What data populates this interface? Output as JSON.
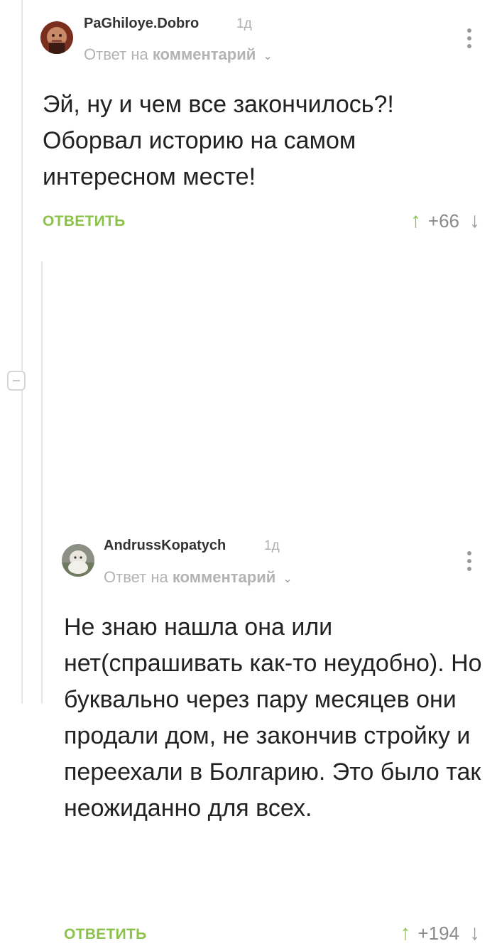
{
  "comments": [
    {
      "username": "PaGhiloye.Dobro",
      "time": "1д",
      "reply_prefix": "Ответ на",
      "reply_target": "комментарий",
      "text": "Эй, ну и чем все закончилось?! Оборвал историю на самом интересном месте!",
      "reply_label": "ОТВЕТИТЬ",
      "score": "+66"
    },
    {
      "username": "AndrussKopatych",
      "time": "1д",
      "reply_prefix": "Ответ на",
      "reply_target": "комментарий",
      "text": "Не знаю нашла она или нет(спрашивать как-то неудобно). Но буквально через пару месяцев они продали дом, не закончив стройку и переехали в Болгарию. Это было так неожиданно для всех.",
      "reply_label": "ОТВЕТИТЬ",
      "score": "+194"
    }
  ],
  "icons": {
    "upvote": "arrow-up-icon",
    "downvote": "arrow-down-icon",
    "more": "more-vertical-icon",
    "collapse": "collapse-minus-icon"
  },
  "colors": {
    "accent_green": "#8bc34a",
    "muted_gray": "#b3b3b3",
    "text": "#222222"
  }
}
